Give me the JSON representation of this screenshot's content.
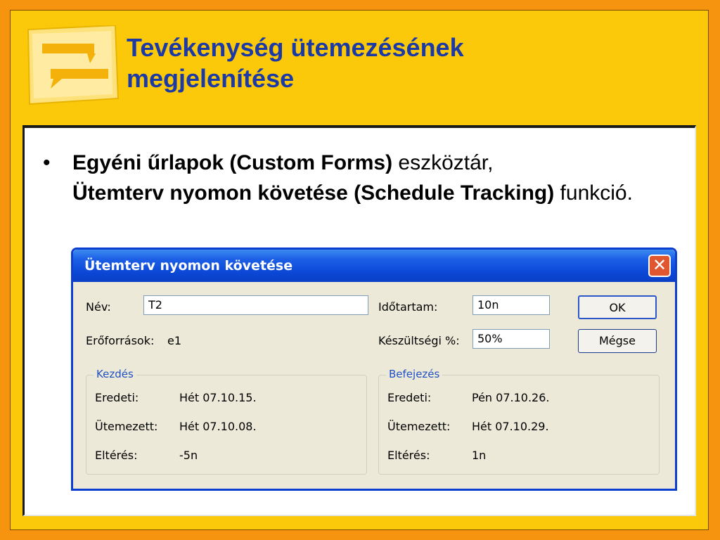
{
  "slide": {
    "title_line1": "Tevékenység ütemezésének",
    "title_line2": "megjelenítése",
    "bullet": {
      "part1_bold": "Egyéni űrlapok (Custom Forms)",
      "part2": " eszköztár,",
      "part3_bold": "Ütemterv nyomon követése (Schedule Tracking)",
      "part4": " funkció."
    }
  },
  "dialog": {
    "title": "Ütemterv nyomon követése",
    "close_symbol": "✕",
    "name_label": "Név:",
    "name_value": "T2",
    "duration_label": "Időtartam:",
    "duration_value": "10n",
    "resources_label": "Erőforrások:",
    "resources_value": "e1",
    "percent_label": "Készültségi %:",
    "percent_value": "50%",
    "ok_label": "OK",
    "cancel_label": "Mégse",
    "start_group": {
      "title": "Kezdés",
      "rows": [
        {
          "label": "Eredeti:",
          "value": "Hét 07.10.15."
        },
        {
          "label": "Ütemezett:",
          "value": "Hét 07.10.08."
        },
        {
          "label": "Eltérés:",
          "value": "-5n"
        }
      ]
    },
    "finish_group": {
      "title": "Befejezés",
      "rows": [
        {
          "label": "Eredeti:",
          "value": "Pén 07.10.26."
        },
        {
          "label": "Ütemezett:",
          "value": "Hét 07.10.29."
        },
        {
          "label": "Eltérés:",
          "value": "1n"
        }
      ]
    }
  }
}
